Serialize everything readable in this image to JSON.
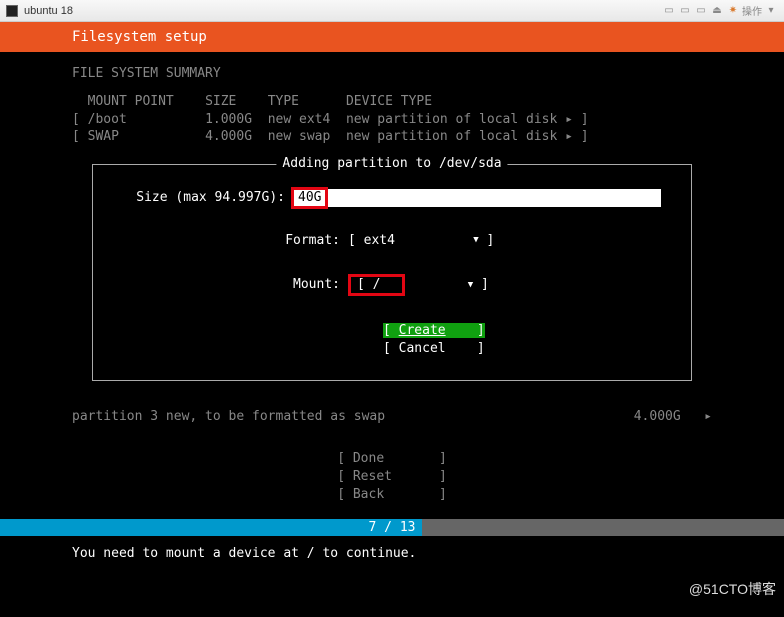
{
  "window": {
    "title": "ubuntu 18",
    "action_label": "操作"
  },
  "header": {
    "title": "Filesystem setup"
  },
  "summary": {
    "title": "FILE SYSTEM SUMMARY",
    "col_mount": "MOUNT POINT",
    "col_size": "SIZE",
    "col_type": "TYPE",
    "col_devtype": "DEVICE TYPE",
    "rows": [
      {
        "mount": "/boot",
        "size": "1.000G",
        "type": "new ext4",
        "devtype": "new partition of local disk ▸ ]"
      },
      {
        "mount": "SWAP",
        "size": "4.000G",
        "type": "new swap",
        "devtype": "new partition of local disk ▸ ]"
      }
    ]
  },
  "dialog": {
    "title": "Adding partition to /dev/sda",
    "size_label": "Size (max 94.997G):",
    "size_value": "40G",
    "format_label": "Format:",
    "format_value": "ext4",
    "mount_label": "Mount:",
    "mount_value": "/",
    "bracket_open": "[",
    "bracket_close": "]",
    "create_btn": "Create",
    "cancel_btn": "Cancel"
  },
  "below": {
    "desc": "partition 3  new, to be formatted as swap",
    "size": "4.000G",
    "arrow": "▸"
  },
  "bottom": {
    "done": "Done",
    "reset": "Reset",
    "back": "Back"
  },
  "progress": {
    "current": 7,
    "total": 13,
    "text": "7 / 13"
  },
  "footer": {
    "msg": "You need to mount a device at / to continue."
  },
  "watermark": "@51CTO博客"
}
